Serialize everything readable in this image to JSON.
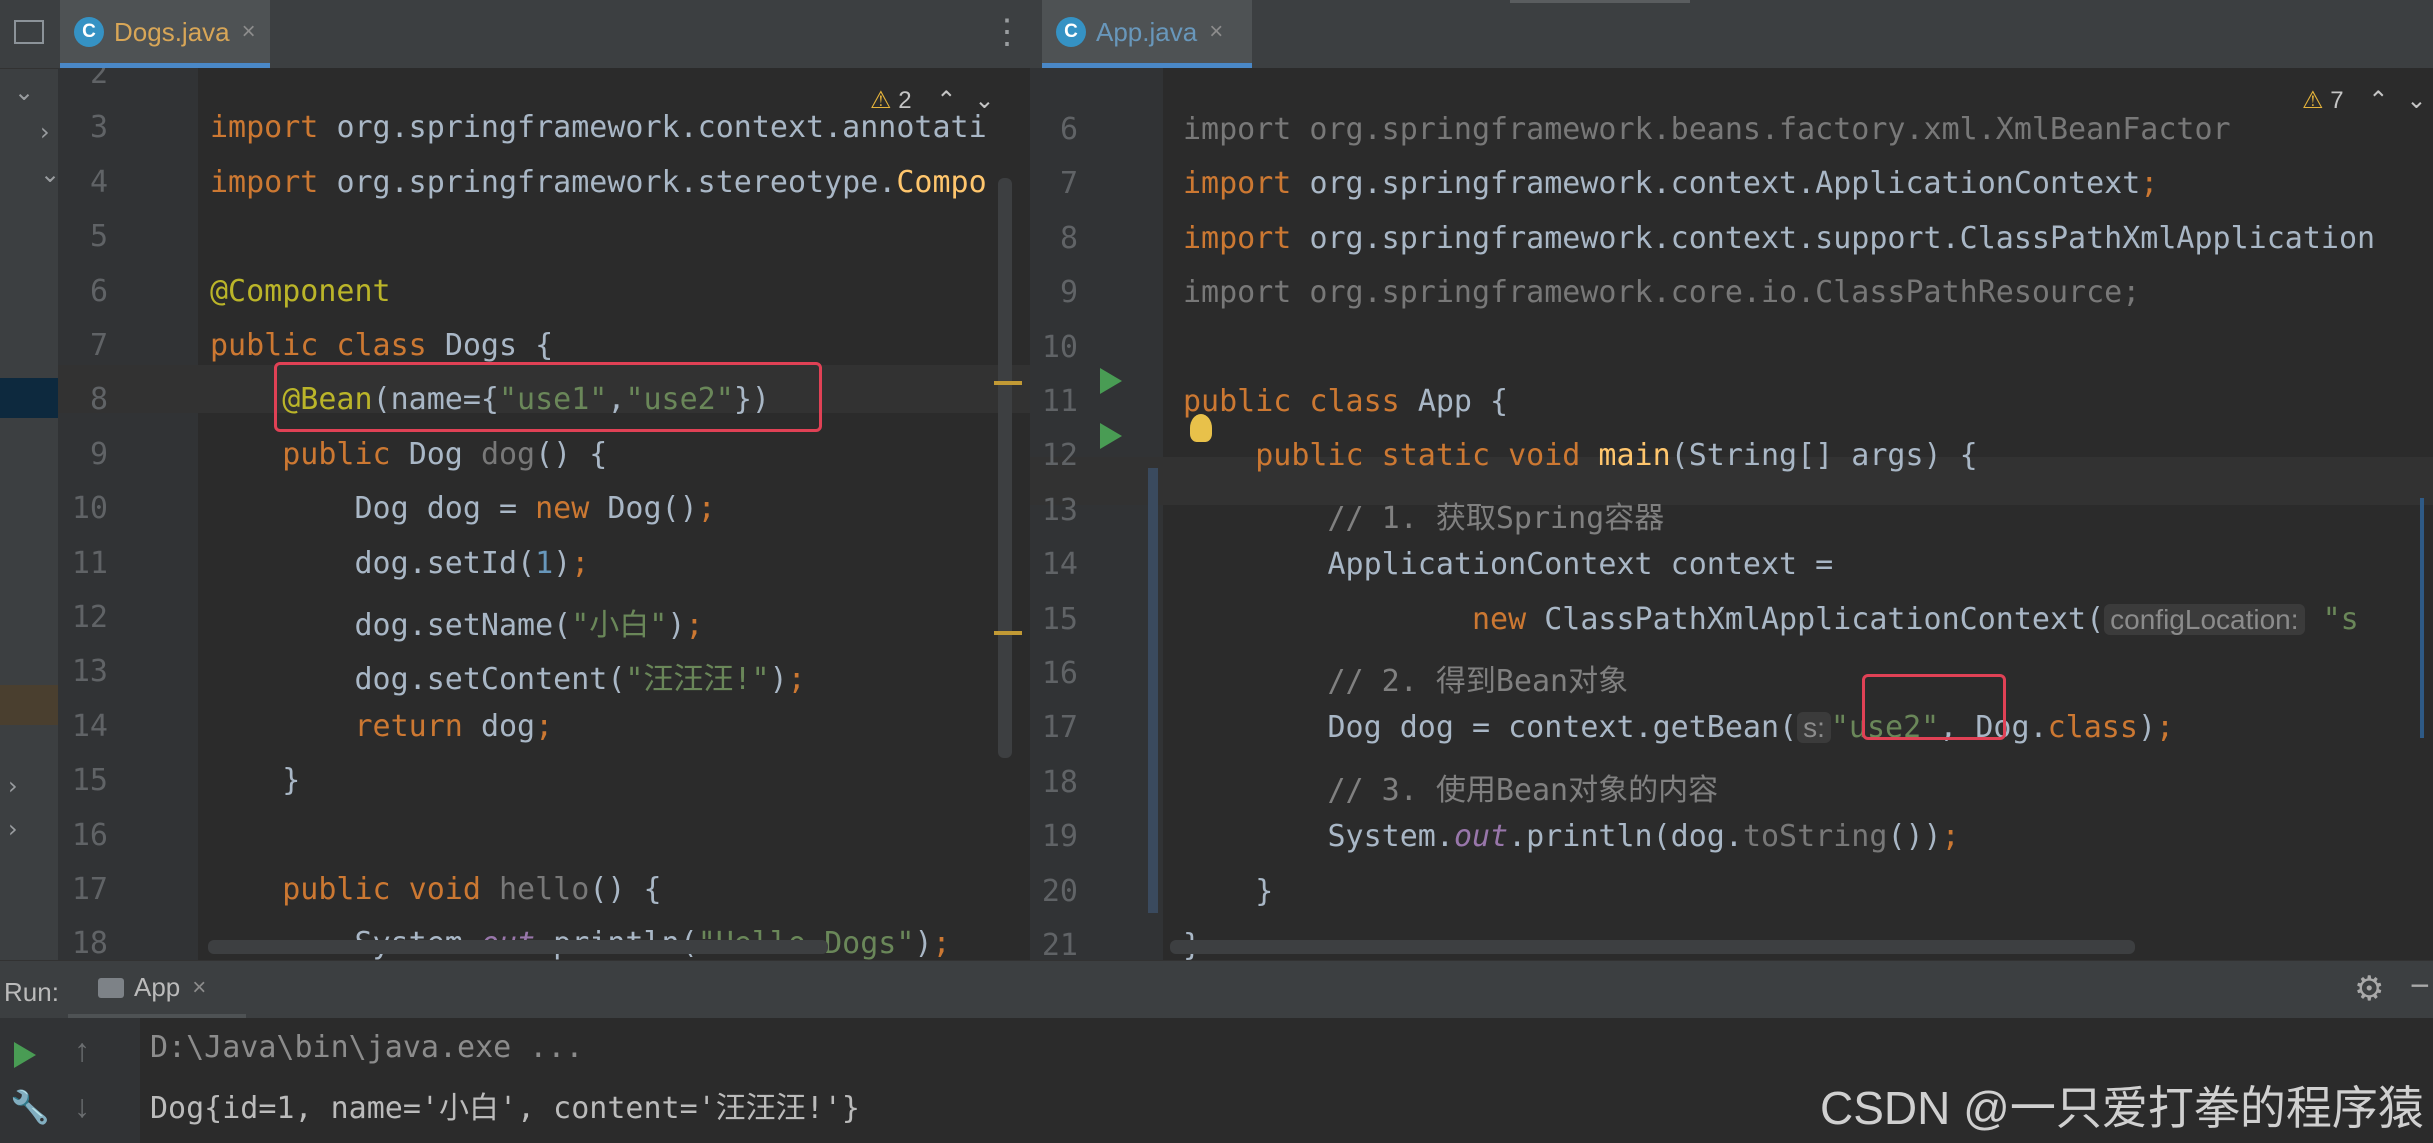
{
  "left_tab": {
    "icon": "C",
    "title": "Dogs.java",
    "close": "×"
  },
  "right_tab": {
    "icon": "C",
    "title": "App.java",
    "close": "×"
  },
  "left_editor": {
    "warnings": "2",
    "lines": [
      {
        "n": "2",
        "t": []
      },
      {
        "n": "3",
        "t": [
          [
            "kw",
            "import "
          ],
          [
            "",
            "org.springframework.context.annotati"
          ]
        ]
      },
      {
        "n": "4",
        "t": [
          [
            "kw",
            "import "
          ],
          [
            "",
            "org.springframework.stereotype."
          ],
          [
            "fn",
            "Compo"
          ]
        ]
      },
      {
        "n": "5",
        "t": []
      },
      {
        "n": "6",
        "t": [
          [
            "ann",
            "@Component"
          ]
        ]
      },
      {
        "n": "7",
        "t": [
          [
            "kw",
            "public class "
          ],
          [
            "",
            "Dogs {"
          ]
        ]
      },
      {
        "n": "8",
        "t": [
          [
            "",
            "    "
          ],
          [
            "ann",
            "@Bean"
          ],
          [
            "",
            "(name={"
          ],
          [
            "str",
            "\"use1\""
          ],
          [
            "",
            ","
          ],
          [
            "str",
            "\"use2\""
          ],
          [
            "",
            "})"
          ]
        ]
      },
      {
        "n": "9",
        "t": [
          [
            "",
            "    "
          ],
          [
            "kw",
            "public "
          ],
          [
            "",
            "Dog "
          ],
          [
            "gray",
            "dog"
          ],
          [
            "",
            "() {"
          ]
        ]
      },
      {
        "n": "10",
        "t": [
          [
            "",
            "        Dog dog = "
          ],
          [
            "kw",
            "new "
          ],
          [
            "",
            "Dog()"
          ],
          [
            "kw",
            ";"
          ]
        ]
      },
      {
        "n": "11",
        "t": [
          [
            "",
            "        dog.setId("
          ],
          [
            "num",
            "1"
          ],
          [
            "",
            ")"
          ],
          [
            "kw",
            ";"
          ]
        ]
      },
      {
        "n": "12",
        "t": [
          [
            "",
            "        dog.setName("
          ],
          [
            "str",
            "\"小白\""
          ],
          [
            "",
            ")"
          ],
          [
            "kw",
            ";"
          ]
        ]
      },
      {
        "n": "13",
        "t": [
          [
            "",
            "        dog.setContent("
          ],
          [
            "str",
            "\"汪汪汪!\""
          ],
          [
            "",
            ")"
          ],
          [
            "kw",
            ";"
          ]
        ]
      },
      {
        "n": "14",
        "t": [
          [
            "",
            "        "
          ],
          [
            "kw",
            "return "
          ],
          [
            "",
            "dog"
          ],
          [
            "kw",
            ";"
          ]
        ]
      },
      {
        "n": "15",
        "t": [
          [
            "",
            "    }"
          ]
        ]
      },
      {
        "n": "16",
        "t": []
      },
      {
        "n": "17",
        "t": [
          [
            "",
            "    "
          ],
          [
            "kw",
            "public void "
          ],
          [
            "gray",
            "hello"
          ],
          [
            "",
            "() {"
          ]
        ]
      },
      {
        "n": "18",
        "t": [
          [
            "",
            "        System."
          ],
          [
            "stat",
            "out"
          ],
          [
            "",
            ".println("
          ],
          [
            "str",
            "\"Hello Dogs\""
          ],
          [
            "",
            ")"
          ],
          [
            "kw",
            ";"
          ]
        ]
      }
    ]
  },
  "right_editor": {
    "warnings": "7",
    "lines": [
      {
        "n": "6",
        "t": [
          [
            "gray",
            "import org.springframework.beans.factory.xml.XmlBeanFactor"
          ]
        ]
      },
      {
        "n": "7",
        "t": [
          [
            "kw",
            "import "
          ],
          [
            "",
            "org.springframework.context.ApplicationContext"
          ],
          [
            "kw",
            ";"
          ]
        ]
      },
      {
        "n": "8",
        "t": [
          [
            "kw",
            "import "
          ],
          [
            "",
            "org.springframework.context.support.ClassPathXmlApplication"
          ]
        ]
      },
      {
        "n": "9",
        "t": [
          [
            "gray",
            "import org.springframework.core.io.ClassPathResource;"
          ]
        ]
      },
      {
        "n": "10",
        "t": []
      },
      {
        "n": "11",
        "t": [
          [
            "kw",
            "public class "
          ],
          [
            "",
            "App {"
          ]
        ]
      },
      {
        "n": "12",
        "t": [
          [
            "",
            "    "
          ],
          [
            "kw",
            "public static void "
          ],
          [
            "fn",
            "main"
          ],
          [
            "",
            "(String[] args) {"
          ]
        ]
      },
      {
        "n": "13",
        "t": [
          [
            "",
            "        "
          ],
          [
            "cm",
            "// 1. 获取Spring容器"
          ]
        ]
      },
      {
        "n": "14",
        "t": [
          [
            "",
            "        ApplicationContext context ="
          ]
        ]
      },
      {
        "n": "15",
        "t": [
          [
            "",
            "                "
          ],
          [
            "kw",
            "new "
          ],
          [
            "",
            "ClassPathXmlApplicationContext("
          ],
          [
            "hint",
            "configLocation:"
          ],
          [
            "str",
            " \"s"
          ]
        ]
      },
      {
        "n": "16",
        "t": [
          [
            "",
            "        "
          ],
          [
            "cm",
            "// 2. 得到Bean对象"
          ]
        ]
      },
      {
        "n": "17",
        "t": [
          [
            "",
            "        Dog dog = context.getBean("
          ],
          [
            "hint",
            "s:"
          ],
          [
            "str",
            "\"use2\""
          ],
          [
            "",
            ", Dog."
          ],
          [
            "kw",
            "class"
          ],
          [
            "",
            ")"
          ],
          [
            "kw",
            ";"
          ]
        ]
      },
      {
        "n": "18",
        "t": [
          [
            "",
            "        "
          ],
          [
            "cm",
            "// 3. 使用Bean对象的内容"
          ]
        ]
      },
      {
        "n": "19",
        "t": [
          [
            "",
            "        System."
          ],
          [
            "stat",
            "out"
          ],
          [
            "",
            ".println(dog."
          ],
          [
            "gray",
            "toString"
          ],
          [
            "",
            "())"
          ],
          [
            "kw",
            ";"
          ]
        ]
      },
      {
        "n": "20",
        "t": [
          [
            "",
            "    }"
          ]
        ]
      },
      {
        "n": "21",
        "t": [
          [
            "",
            "}"
          ]
        ]
      }
    ]
  },
  "run": {
    "label": "Run:",
    "tab": "App",
    "close": "×",
    "console": [
      "D:\\Java\\bin\\java.exe ...",
      "Dog{id=1, name='小白', content='汪汪汪!'}"
    ]
  },
  "watermark": "CSDN @一只爱打拳的程序猿",
  "colors": {
    "accent": "#4a88c7",
    "highlight_box": "#e04155",
    "run_green": "#499c54"
  }
}
